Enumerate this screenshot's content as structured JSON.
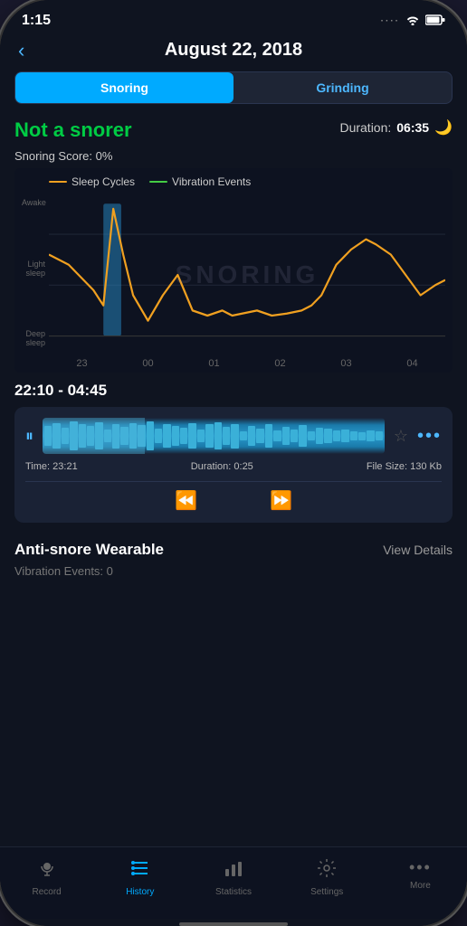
{
  "statusBar": {
    "time": "1:15",
    "wifi": "wifi",
    "battery": "battery"
  },
  "header": {
    "backLabel": "‹",
    "title": "August 22, 2018"
  },
  "tabToggle": {
    "snoring": "Snoring",
    "grinding": "Grinding",
    "activeTab": "snoring"
  },
  "scoreSection": {
    "title": "Not a snorer",
    "durationLabel": "Duration:",
    "durationValue": "06:35",
    "snoringScoreLabel": "Snoring Score:",
    "snoringScoreValue": "0%"
  },
  "chartLegend": {
    "sleepCycles": "Sleep Cycles",
    "vibrationEvents": "Vibration Events"
  },
  "chartYLabels": [
    "Awake",
    "Light sleep",
    "Deep sleep"
  ],
  "chartXLabels": [
    "23",
    "00",
    "01",
    "02",
    "03",
    "04"
  ],
  "chartWatermark": "SNORING",
  "timeRange": "22:10 - 04:45",
  "audioPlayer": {
    "timeLabel": "Time:",
    "timeValue": "23:21",
    "durationLabel": "Duration:",
    "durationValue": "0:25",
    "fileSizeLabel": "File Size:",
    "fileSizeValue": "130 Kb"
  },
  "wearable": {
    "title": "Anti-snore Wearable",
    "viewDetails": "View Details",
    "vibrationEventsLabel": "Vibration Events: 0"
  },
  "bottomNav": {
    "items": [
      {
        "id": "record",
        "label": "Record",
        "icon": "mic",
        "active": false
      },
      {
        "id": "history",
        "label": "History",
        "icon": "list",
        "active": true
      },
      {
        "id": "statistics",
        "label": "Statistics",
        "icon": "chart",
        "active": false
      },
      {
        "id": "settings",
        "label": "Settings",
        "icon": "gear",
        "active": false
      },
      {
        "id": "more",
        "label": "More",
        "icon": "dots",
        "active": false
      }
    ]
  }
}
